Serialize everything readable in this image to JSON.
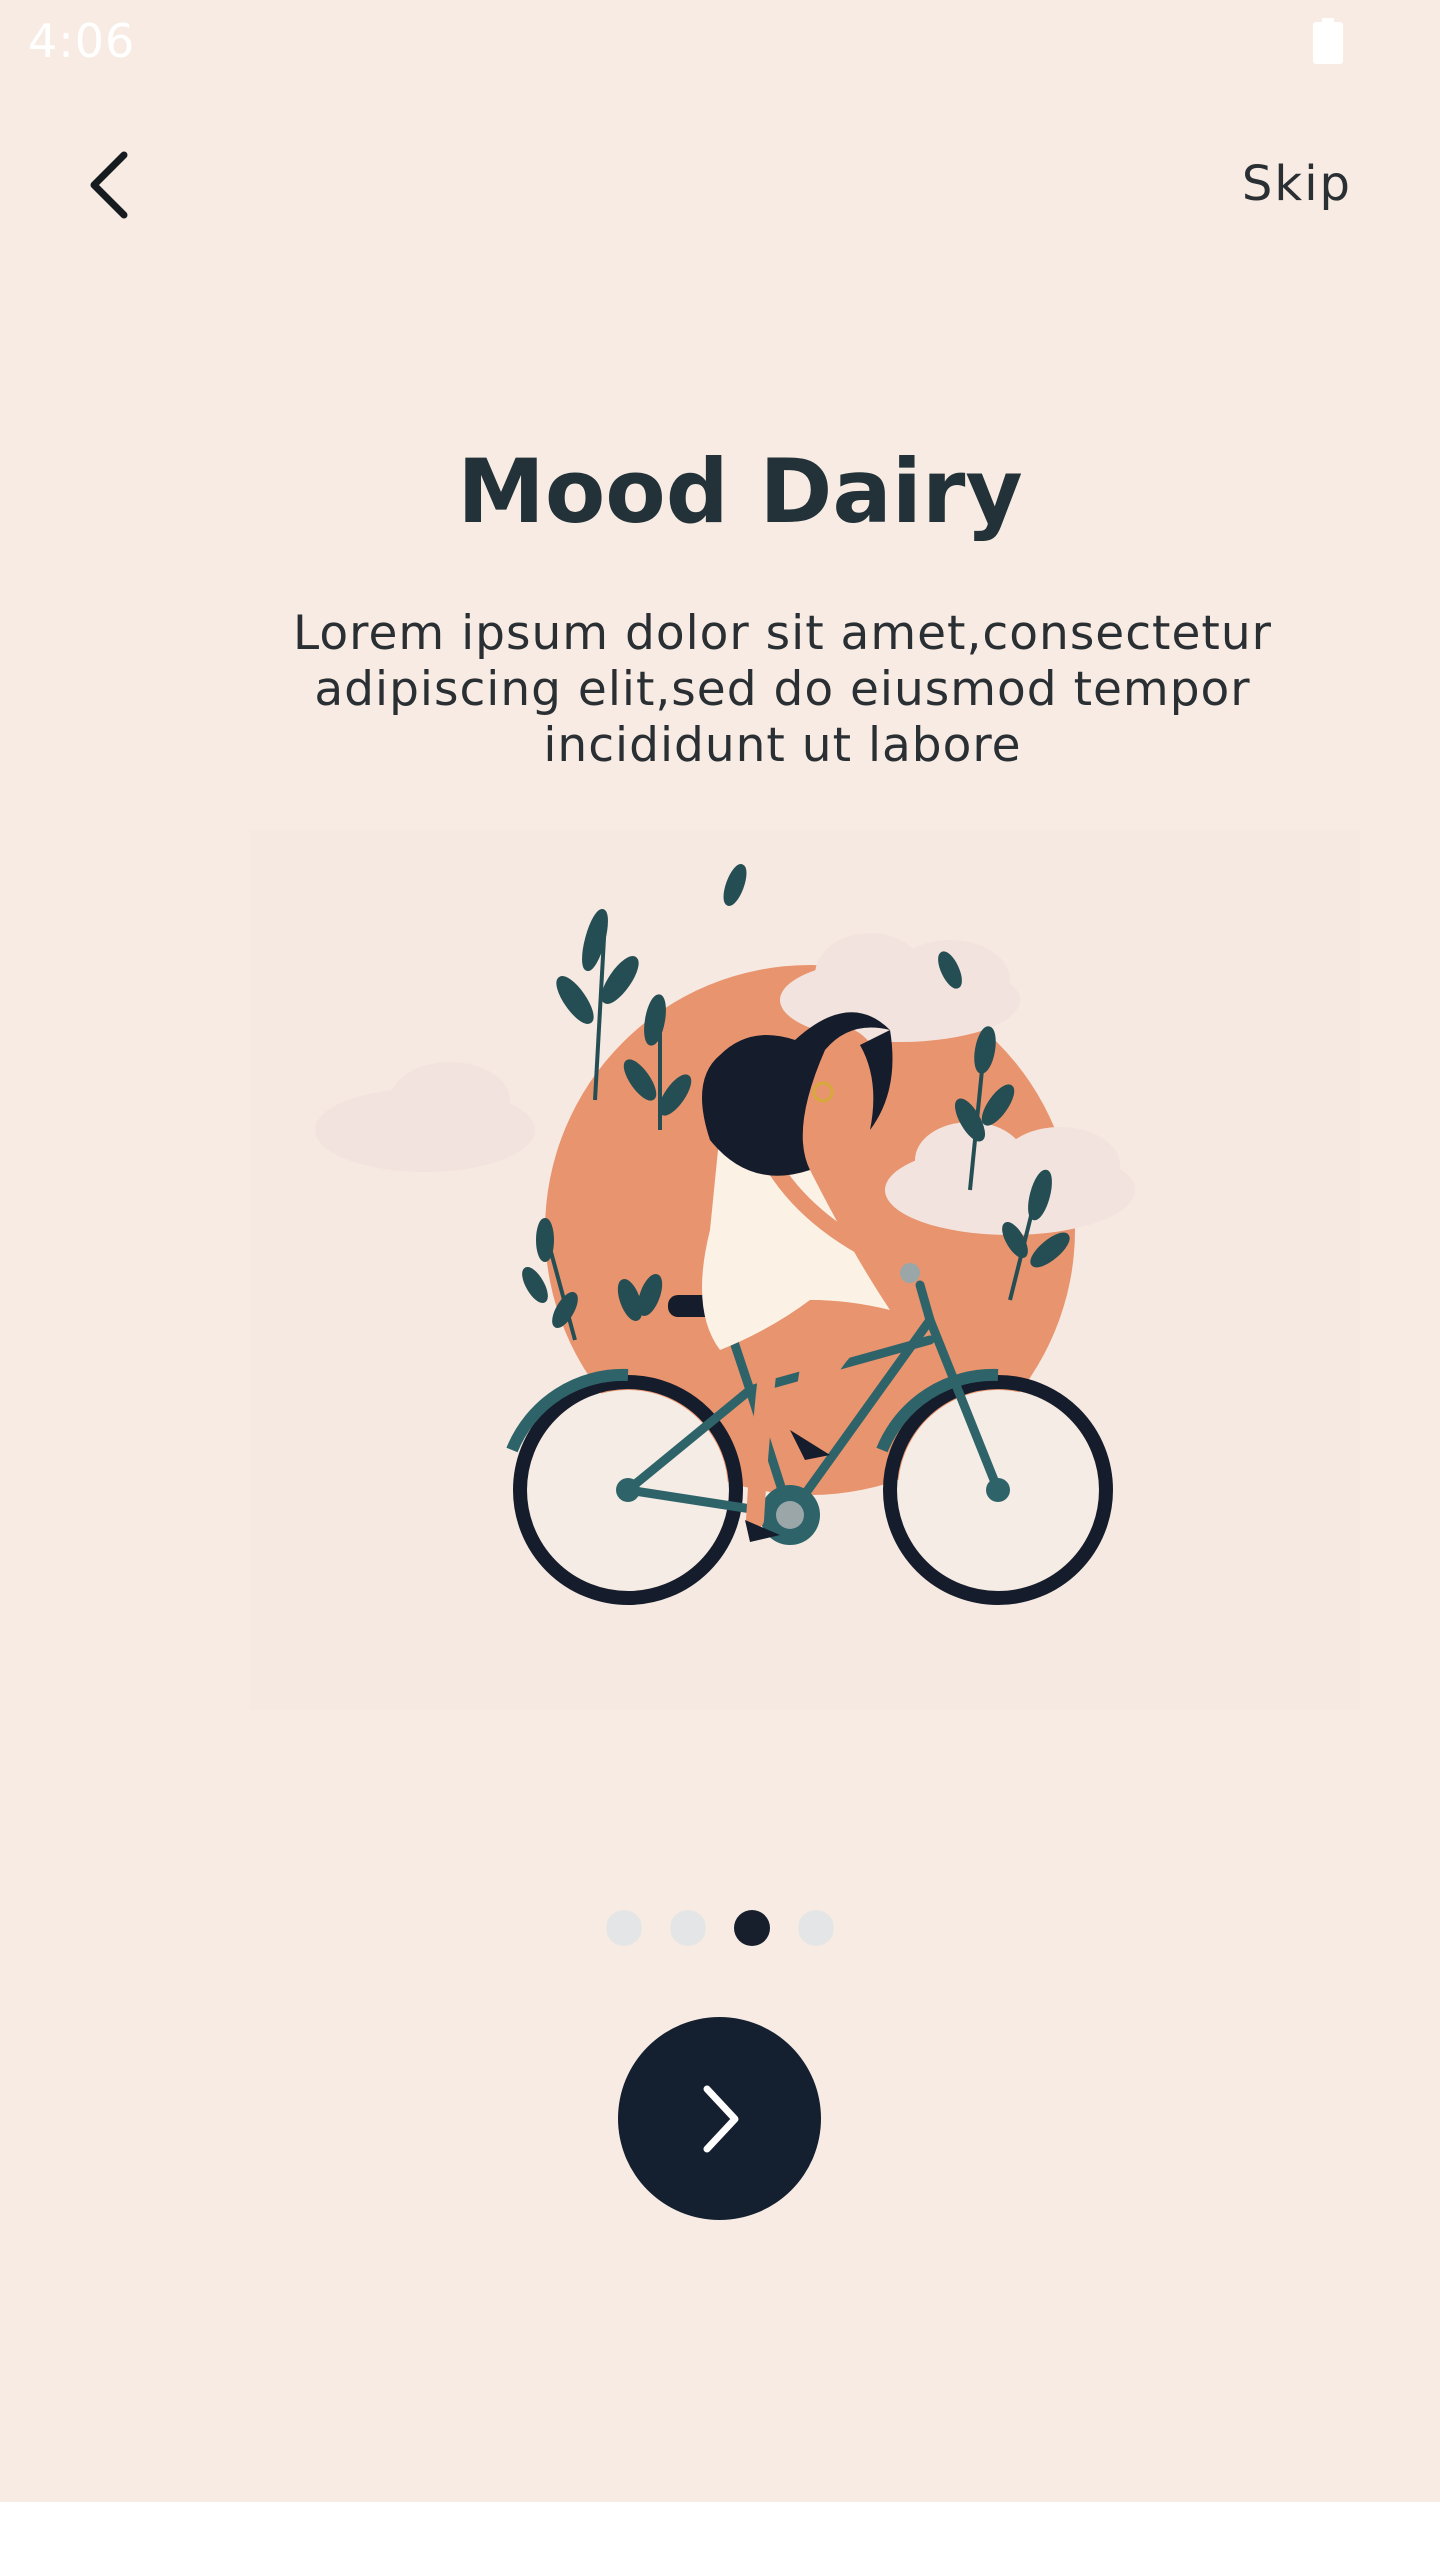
{
  "status_bar": {
    "time": "4:06"
  },
  "header": {
    "skip_label": "Skip"
  },
  "onboarding": {
    "title": "Mood Dairy",
    "description": "Lorem ipsum dolor sit amet,consectetur adipiscing elit,sed do eiusmod tempor incididunt ut labore",
    "illustration": "woman-riding-bicycle-illustration",
    "page_count": 4,
    "current_page": 3
  },
  "colors": {
    "background": "#f7ebe3",
    "accent_dark": "#141f30",
    "title": "#223238",
    "sun": "#e8946e",
    "dot_inactive": "#e4e5e6",
    "dot_active": "#161f2b"
  },
  "icons": {
    "back": "chevron-left-icon",
    "next": "chevron-right-icon",
    "battery": "battery-icon"
  }
}
